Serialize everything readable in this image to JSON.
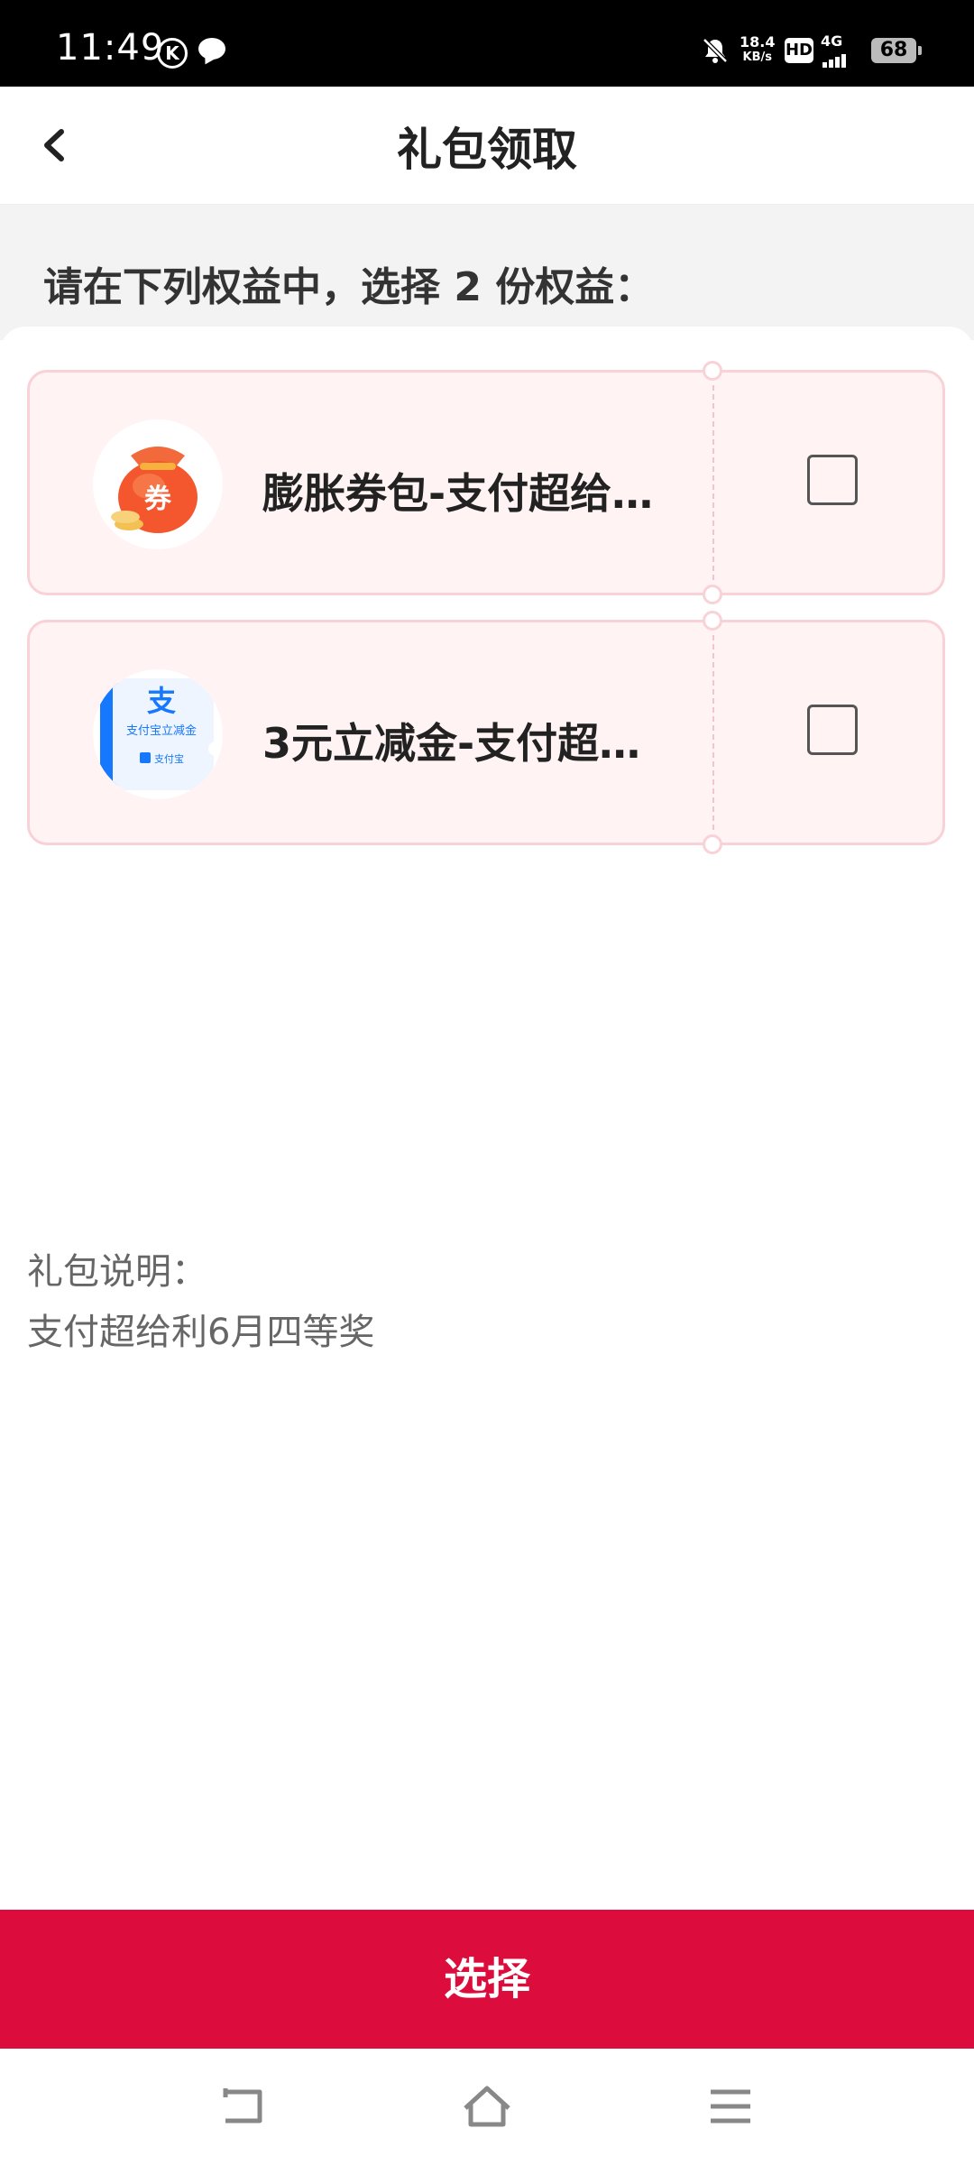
{
  "status_bar": {
    "time": "11:49",
    "k_badge": "K",
    "net_speed_value": "18.4",
    "net_speed_unit": "KB/s",
    "hd_label": "HD",
    "network": "4G",
    "battery": "68"
  },
  "header": {
    "title": "礼包领取"
  },
  "instruction": "请在下列权益中，选择 2 份权益：",
  "items": [
    {
      "title": "膨胀券包-支付超给…",
      "icon": "coupon-bag-icon",
      "icon_text": "券",
      "checked": false
    },
    {
      "title": "3元立减金-支付超…",
      "icon": "alipay-voucher-icon",
      "icon_text_main": "支",
      "icon_text_sub": "支付宝立减金",
      "icon_text_brand": "支付宝",
      "checked": false
    }
  ],
  "description": {
    "label": "礼包说明：",
    "text": "支付超给利6月四等奖"
  },
  "action": {
    "select_label": "选择"
  },
  "colors": {
    "accent": "#dc0d3c",
    "card_bg": "#fff3f3",
    "card_border": "#f8d2d7"
  }
}
